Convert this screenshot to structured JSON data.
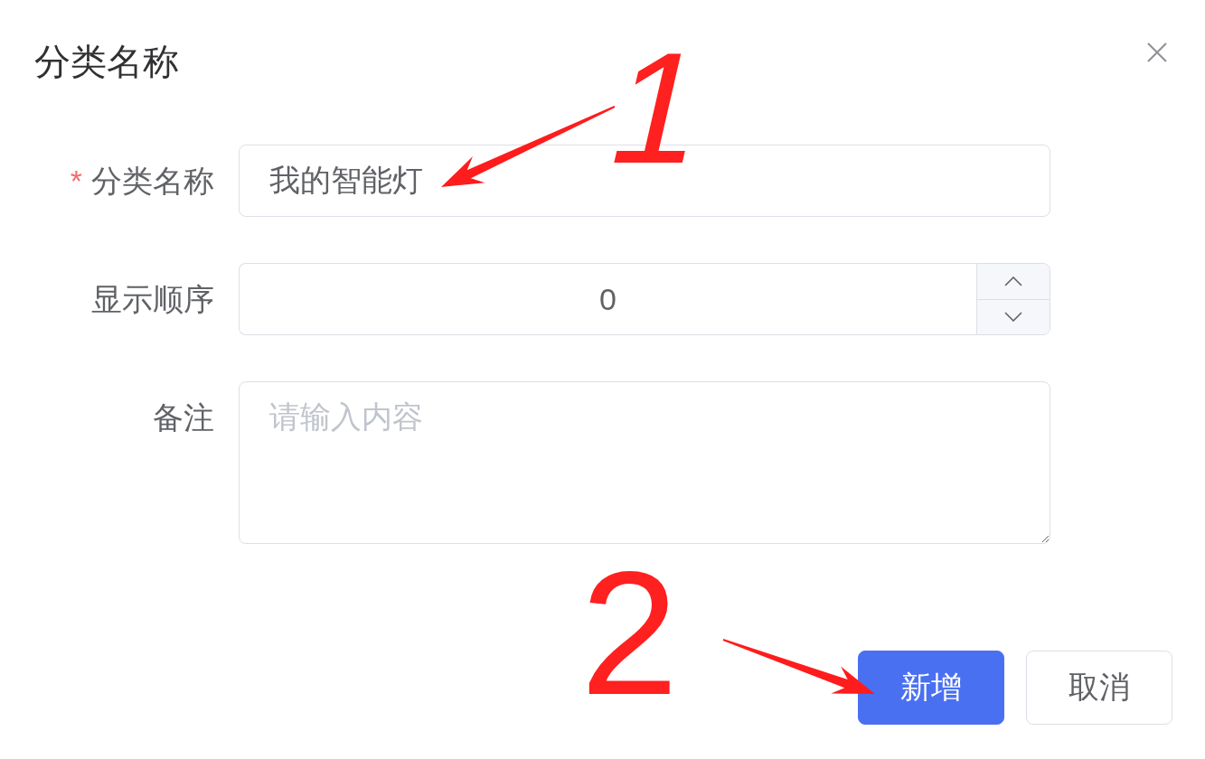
{
  "dialog": {
    "title": "分类名称"
  },
  "form": {
    "required_mark": "*",
    "fields": [
      {
        "kind": "text",
        "label": "分类名称",
        "required": true,
        "value": "我的智能灯"
      },
      {
        "kind": "number",
        "label": "显示顺序",
        "required": false,
        "value": "0"
      },
      {
        "kind": "textarea",
        "label": "备注",
        "required": false,
        "placeholder": "请输入内容"
      }
    ]
  },
  "buttons": [
    {
      "label": "新增",
      "primary": true
    },
    {
      "label": "取消",
      "primary": false
    }
  ],
  "annotations": [
    {
      "label": "1",
      "arrow": true
    },
    {
      "label": "2",
      "arrow": true
    }
  ]
}
